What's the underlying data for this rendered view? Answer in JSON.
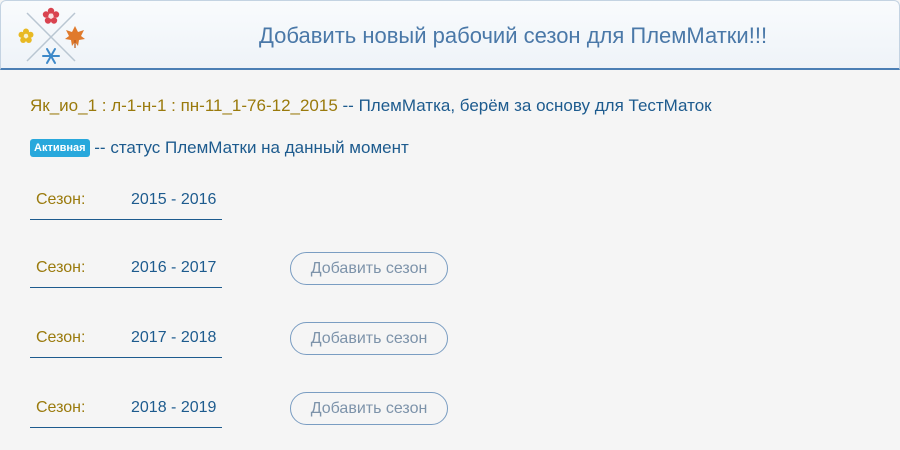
{
  "header": {
    "title": "Добавить новый рабочий сезон для ПлемМатки!!!",
    "logo_icon": "four-seasons-logo-icon"
  },
  "hive": {
    "id": "Як_ио_1 : л-1-н-1 : пн-11_1-76-12_2015",
    "description": " -- ПлемМатка, берём за основу для ТестМаток"
  },
  "status": {
    "badge": "Активная",
    "description": " -- статус ПлемМатки на данный момент",
    "badge_color": "#28a8dc"
  },
  "seasons": [
    {
      "label": "Сезон:",
      "years": "2015 - 2016",
      "button": null
    },
    {
      "label": "Сезон:",
      "years": "2016 - 2017",
      "button": "Добавить сезон"
    },
    {
      "label": "Сезон:",
      "years": "2017 - 2018",
      "button": "Добавить сезон"
    },
    {
      "label": "Сезон:",
      "years": "2018 - 2019",
      "button": "Добавить сезон"
    }
  ],
  "colors": {
    "accent": "#4a78a8",
    "gold_text": "#9a7a0c",
    "blue_text": "#1d5b8e"
  }
}
